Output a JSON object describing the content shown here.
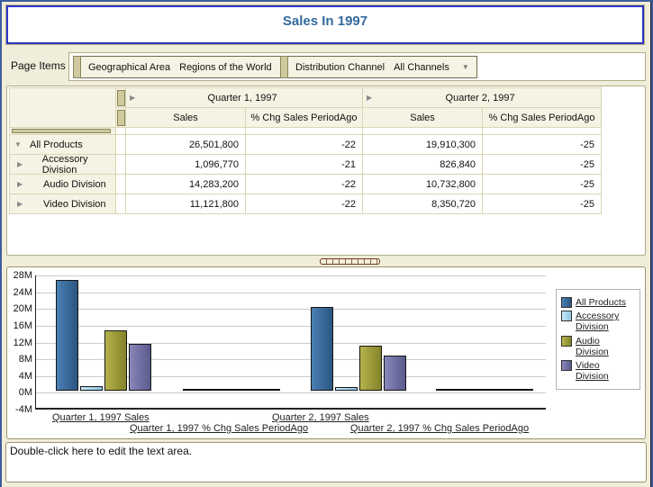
{
  "window": {
    "title": "Sales In 1997"
  },
  "icons": {
    "row_expanded": "▼",
    "row_collapsed": "▶",
    "column_drill": "▶",
    "dropdown_arrow": "▼"
  },
  "page_items": {
    "label": "Page Items",
    "selectors": [
      {
        "dimension": "Geographical Area",
        "value": "Regions of the World"
      },
      {
        "dimension": "Distribution Channel",
        "value": "All Channels"
      }
    ]
  },
  "crosstab": {
    "column_groups": [
      {
        "label": "Quarter 1, 1997"
      },
      {
        "label": "Quarter 2, 1997"
      }
    ],
    "sub_columns": [
      "Sales",
      "% Chg Sales PeriodAgo",
      "Sales",
      "% Chg Sales PeriodAgo"
    ],
    "rows": [
      {
        "label": "All Products",
        "state": "expanded",
        "values": [
          "26,501,800",
          "-22",
          "19,910,300",
          "-25"
        ]
      },
      {
        "label": "Accessory Division",
        "state": "collapsed",
        "values": [
          "1,096,770",
          "-21",
          "826,840",
          "-25"
        ]
      },
      {
        "label": "Audio Division",
        "state": "collapsed",
        "values": [
          "14,283,200",
          "-22",
          "10,732,800",
          "-25"
        ]
      },
      {
        "label": "Video Division",
        "state": "collapsed",
        "values": [
          "11,121,800",
          "-22",
          "8,350,720",
          "-25"
        ]
      }
    ]
  },
  "chart_data": {
    "type": "bar",
    "categories": [
      "Quarter 1, 1997 Sales",
      "Quarter 1, 1997 % Chg Sales PeriodAgo",
      "Quarter 2, 1997 Sales",
      "Quarter 2, 1997 % Chg Sales PeriodAgo"
    ],
    "series": [
      {
        "name": "All Products",
        "gradient": [
          "#4a80b4",
          "#2b5580"
        ],
        "values": [
          26501800,
          -22,
          19910300,
          -25
        ]
      },
      {
        "name": "Accessory Division",
        "gradient": [
          "#c9e9f8",
          "#8ec6e6"
        ],
        "values": [
          1096770,
          -21,
          826840,
          -25
        ]
      },
      {
        "name": "Audio Division",
        "gradient": [
          "#b5b34b",
          "#84832a"
        ],
        "values": [
          14283200,
          -22,
          10732800,
          -25
        ]
      },
      {
        "name": "Video Division",
        "gradient": [
          "#8887ba",
          "#5b5a8d"
        ],
        "values": [
          11121800,
          -22,
          8350720,
          -25
        ]
      }
    ],
    "y_ticks": [
      "28M",
      "24M",
      "20M",
      "16M",
      "12M",
      "8M",
      "4M",
      "0M",
      "-4M"
    ],
    "ylim": [
      -4000000,
      28000000
    ],
    "grid": true,
    "legend_position": "right"
  },
  "text_area": {
    "content": "Double-click here to edit the text area."
  },
  "colors": {
    "title_blue": "#336a9e",
    "window_border": "#3d5c9e",
    "window_bg": "#f0edda",
    "olive_border": "#98966a",
    "tan_border": "#b2ae88",
    "cream": "#f5f3e3",
    "cell_border": "#d9d5b4",
    "handle_beige": "#cfc99d",
    "title_box_border": "#2a35c8"
  }
}
